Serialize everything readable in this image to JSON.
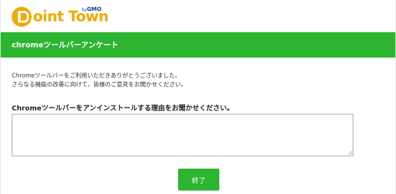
{
  "header": {
    "logo_text": "oint Town",
    "logo_letter": "P",
    "logo_by": "by",
    "logo_brand": "GMO"
  },
  "banner": {
    "title": "chromeツールバーアンケート"
  },
  "intro": {
    "line1": "Chromeツールバーをご利用いただきありがとうございました。",
    "line2": "さらなる機能の改善に向けて、皆様のご意見をお聞かせください。"
  },
  "question": {
    "label": "Chromeツールバーをアンインストールする理由をお聞かせください。",
    "answer_value": ""
  },
  "actions": {
    "finish_label": "終了"
  },
  "colors": {
    "brand_green": "#2cb531",
    "logo_orange": "#f2a900",
    "gmo_blue": "#1a3e8c"
  }
}
